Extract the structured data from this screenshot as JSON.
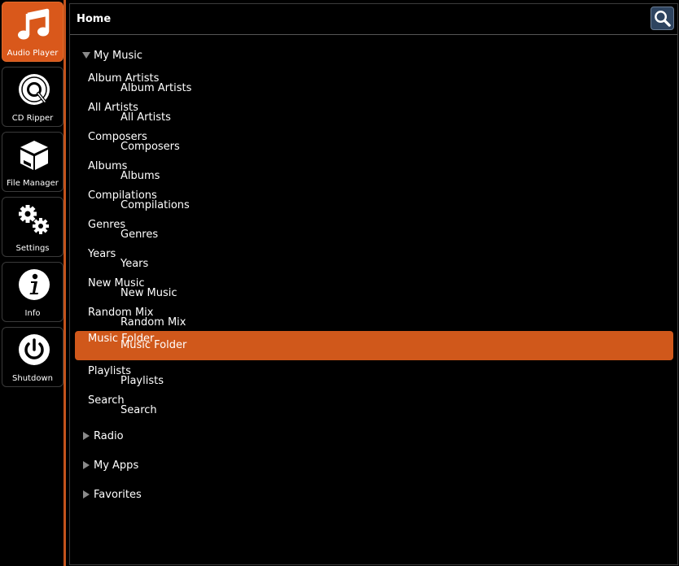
{
  "apps": [
    {
      "label": "Audio Player",
      "icon": "music-note-icon",
      "active": true
    },
    {
      "label": "CD Ripper",
      "icon": "disc-icon",
      "active": false
    },
    {
      "label": "File Manager",
      "icon": "box-icon",
      "active": false
    },
    {
      "label": "Settings",
      "icon": "gears-icon",
      "active": false
    },
    {
      "label": "Info",
      "icon": "info-icon",
      "active": false
    },
    {
      "label": "Shutdown",
      "icon": "power-icon",
      "active": false
    }
  ],
  "header": {
    "title": "Home",
    "search_icon": "search-icon"
  },
  "tree": {
    "my_music": {
      "label": "My Music",
      "expanded": true,
      "items": [
        {
          "label": "Album Artists"
        },
        {
          "label": "All Artists"
        },
        {
          "label": "Composers"
        },
        {
          "label": "Albums"
        },
        {
          "label": "Compilations"
        },
        {
          "label": "Genres"
        },
        {
          "label": "Years"
        },
        {
          "label": "New Music"
        },
        {
          "label": "Random Mix"
        },
        {
          "label": "Music Folder",
          "selected": true
        },
        {
          "label": "Playlists"
        },
        {
          "label": "Search"
        }
      ]
    },
    "radio": {
      "label": "Radio",
      "expanded": false
    },
    "my_apps": {
      "label": "My Apps",
      "expanded": false
    },
    "favorites": {
      "label": "Favorites",
      "expanded": false
    }
  },
  "colors": {
    "accent": "#d9581b",
    "selection": "#d0581b",
    "background": "#000000",
    "search_button": "#2e4460"
  }
}
